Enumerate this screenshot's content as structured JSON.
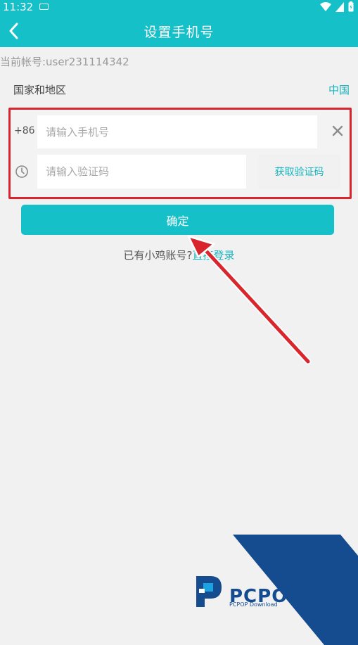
{
  "status_bar": {
    "time": "11:32"
  },
  "header": {
    "title": "设置手机号"
  },
  "account": {
    "label": "当前帐号:user231114342"
  },
  "region": {
    "label": "国家和地区",
    "value": "中国"
  },
  "phone": {
    "prefix": "+86",
    "placeholder": "请输入手机号",
    "value": ""
  },
  "code": {
    "placeholder": "请输入验证码",
    "value": "",
    "get_code_label": "获取验证码"
  },
  "confirm": {
    "label": "确定"
  },
  "login": {
    "question": "已有小鸡账号?",
    "link": "直接登录"
  },
  "watermark": {
    "brand": "PCPOP下载",
    "sub": "PCPOP Download"
  },
  "colors": {
    "accent": "#16c0c8",
    "link": "#16b3bd",
    "annotation": "#d9262c",
    "watermark": "#154b8f"
  }
}
